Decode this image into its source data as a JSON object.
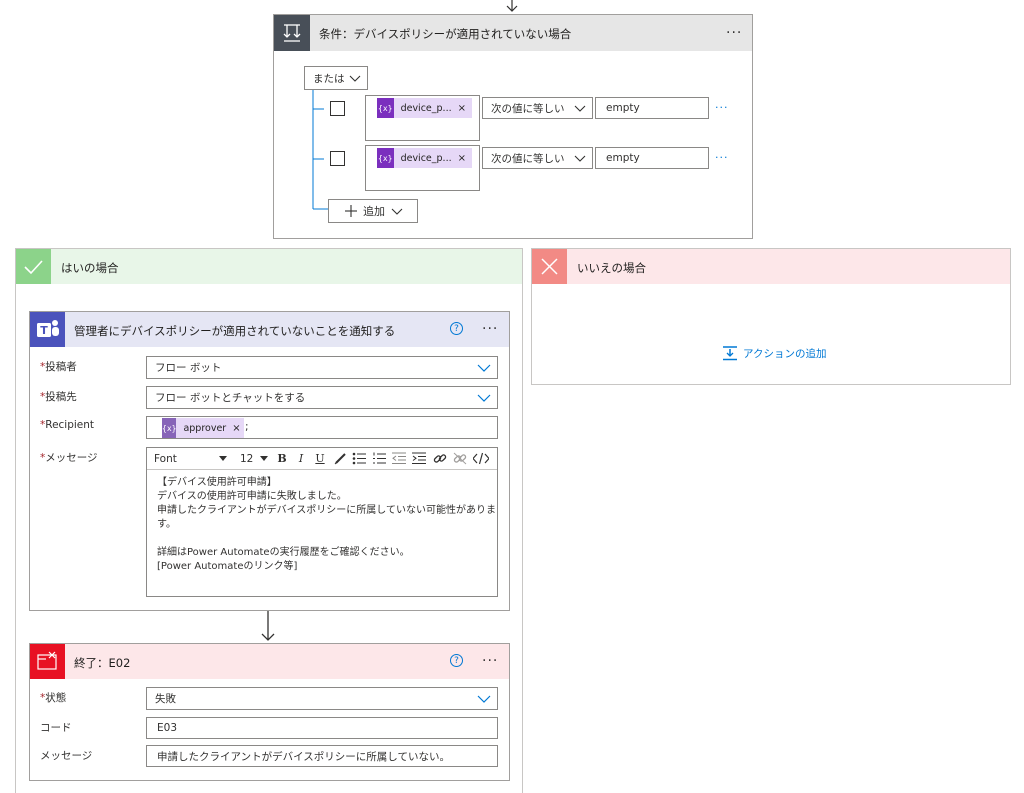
{
  "condition": {
    "title": "条件：デバイスポリシーが適用されていない場合",
    "menu": "···",
    "group_operator": "または",
    "rows": [
      {
        "token": "device_p...",
        "operator": "次の値に等しい",
        "value": "empty",
        "more": "···"
      },
      {
        "token": "device_p...",
        "operator": "次の値に等しい",
        "value": "empty",
        "more": "···"
      }
    ],
    "add_label": "追加",
    "token_icon": "{x}",
    "token_close": "×"
  },
  "yes_branch": {
    "title": "はいの場合",
    "teams_action": {
      "title": "管理者にデバイスポリシーが適用されていないことを通知する",
      "help": "?",
      "menu": "···",
      "fields": {
        "poster": {
          "label": "投稿者",
          "value": "フロー ボット"
        },
        "post_to": {
          "label": "投稿先",
          "value": "フロー ボットとチャットをする"
        },
        "recipient": {
          "label": "Recipient",
          "token": "approver",
          "token_close": "×",
          "suffix": ";"
        },
        "message": {
          "label": "メッセージ",
          "font_select": "Font",
          "size_select": "12",
          "lines": [
            "【デバイス使用許可申請】",
            "デバイスの使用許可申請に失敗しました。",
            "申請したクライアントがデバイスポリシーに所属していない可能性がありま",
            "す。",
            "",
            "詳細はPower Automateの実行履歴をご確認ください。",
            "[Power Automateのリンク等]"
          ]
        }
      }
    },
    "terminate_action": {
      "title": "終了：E02",
      "help": "?",
      "menu": "···",
      "fields": {
        "status": {
          "label": "状態",
          "value": "失敗"
        },
        "code": {
          "label": "コード",
          "value": "E03"
        },
        "message": {
          "label": "メッセージ",
          "value": "申請したクライアントがデバイスポリシーに所属していない。"
        }
      }
    }
  },
  "no_branch": {
    "title": "いいえの場合",
    "add_action_label": "アクションの追加"
  },
  "colors": {
    "condition_header": "#e6e6e6",
    "condition_icon": "#484f58",
    "yes_header": "#e8f6e8",
    "yes_icon": "#8cd38a",
    "no_header": "#fde7e9",
    "no_icon": "#f28a85",
    "teams_header": "#e5e6f4",
    "teams_icon": "#4b53bc",
    "terminate_header": "#fde7e9",
    "terminate_icon": "#e81123",
    "token_bg": "#e6d8f7",
    "token_icon": "#7b2fbe",
    "link": "#0078d4"
  }
}
